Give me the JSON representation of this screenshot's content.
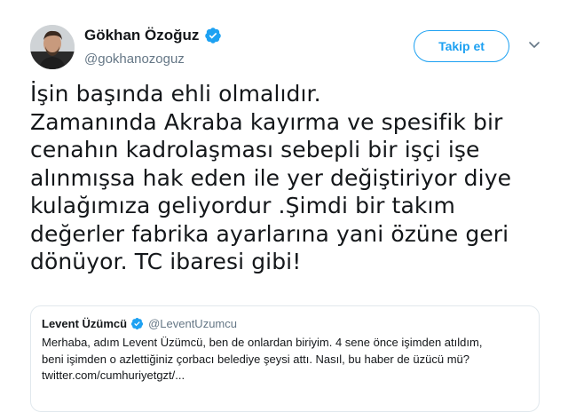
{
  "author": {
    "display_name": "Gökhan Özoğuz",
    "handle": "@gokhanozoguz",
    "verified_icon": "verified-badge-icon",
    "avatar": "avatar-photo"
  },
  "actions": {
    "follow_label": "Takip et",
    "more_icon": "chevron-down-icon"
  },
  "tweet": {
    "text": "İşin başında ehli olmalıdır.\nZamanında Akraba kayırma ve spesifik bir\ncenahın kadrolaşması sebepli bir işçi işe\nalınmışsa hak eden ile yer değiştiriyor diye\nkulağımıza geliyordur .Şimdi bir takım\ndeğerler fabrika ayarlarına yani özüne geri\ndönüyor. TC ibaresi gibi!"
  },
  "quoted_tweet": {
    "display_name": "Levent Üzümcü",
    "handle": "@LeventUzumcu",
    "text": "Merhaba, adım Levent Üzümcü, ben de onlardan biriyim. 4 sene önce işimden atıldım,\nbeni işimden o azlettiğiniz çorbacı belediye şeysi attı. Nasıl, bu haber de üzücü mü?\ntwitter.com/cumhuriyetgzt/..."
  },
  "colors": {
    "accent": "#1da1f2",
    "secondary_text": "#657786",
    "border": "#e1e8ed"
  }
}
